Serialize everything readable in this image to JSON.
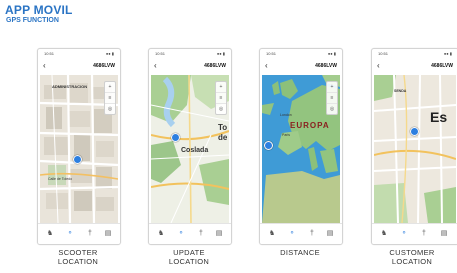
{
  "header": {
    "title": "APP MOVIL",
    "subtitle": "GPS FUNCTION"
  },
  "phones": [
    {
      "status_time": "10:51",
      "status_signal": "●● ▮",
      "back": "‹",
      "plate": "4686LVW",
      "map_labels": [
        "ADMINISTRACION",
        "Calle de Toledo"
      ],
      "tabs": [
        "♞",
        "⚬",
        "†",
        "▤"
      ],
      "caption_line1": "SCOOTER",
      "caption_line2": "LOCATION"
    },
    {
      "status_time": "10:51",
      "status_signal": "●● ▮",
      "back": "‹",
      "plate": "4686LVW",
      "map_labels": [
        "Coslada",
        "To",
        "de"
      ],
      "tabs": [
        "♞",
        "⚬",
        "†",
        "▤"
      ],
      "caption_line1": "UPDATE",
      "caption_line2": "LOCATION"
    },
    {
      "status_time": "10:51",
      "status_signal": "●● ▮",
      "back": "‹",
      "plate": "4686LVW",
      "map_labels": [
        "EUROPA",
        "London",
        "Paris"
      ],
      "tabs": [
        "♞",
        "⚬",
        "†",
        "▤"
      ],
      "caption_line1": "DISTANCE",
      "caption_line2": ""
    },
    {
      "status_time": "10:51",
      "status_signal": "●● ▮",
      "back": "‹",
      "plate": "4686LVW",
      "map_labels": [
        "Es",
        "SENDA"
      ],
      "tabs": [
        "♞",
        "⚬",
        "†",
        "▤"
      ],
      "caption_line1": "CUSTOMER",
      "caption_line2": "LOCATION"
    }
  ],
  "colors": {
    "accent": "#2a74c4",
    "tab_active": "#3a86e0",
    "sea": "#3f9bd6",
    "land_green": "#9cc68a",
    "land_street": "#efe9df"
  }
}
